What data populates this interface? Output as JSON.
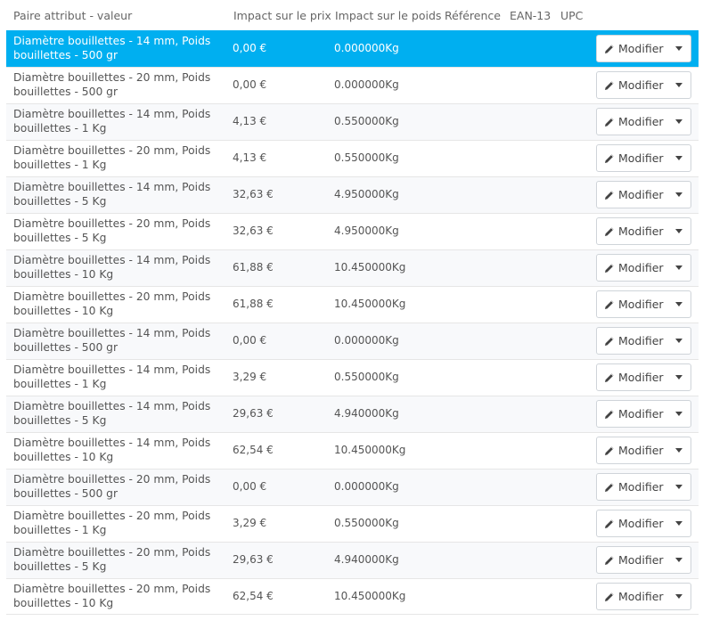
{
  "headers": {
    "attribute": "Paire attribut - valeur",
    "price": "Impact sur le prix",
    "weight": "Impact sur le poids",
    "reference": "Référence",
    "ean13": "EAN-13",
    "upc": "UPC"
  },
  "edit_label": "Modifier",
  "colors": {
    "selected_row": "#00aff0",
    "row_alt": "#f8f9fb"
  },
  "rows": [
    {
      "attr1": "Diamètre bouillettes - 14 mm, Poids",
      "attr2": "bouillettes - 500 gr",
      "price": "0,00 €",
      "weight": "0.000000Kg",
      "selected": true
    },
    {
      "attr1": "Diamètre bouillettes - 20 mm, Poids",
      "attr2": "bouillettes - 500 gr",
      "price": "0,00 €",
      "weight": "0.000000Kg"
    },
    {
      "attr1": "Diamètre bouillettes - 14 mm, Poids",
      "attr2": "bouillettes - 1 Kg",
      "price": "4,13 €",
      "weight": "0.550000Kg"
    },
    {
      "attr1": "Diamètre bouillettes - 20 mm, Poids",
      "attr2": "bouillettes - 1 Kg",
      "price": "4,13 €",
      "weight": "0.550000Kg"
    },
    {
      "attr1": "Diamètre bouillettes - 14 mm, Poids",
      "attr2": "bouillettes - 5 Kg",
      "price": "32,63 €",
      "weight": "4.950000Kg"
    },
    {
      "attr1": "Diamètre bouillettes - 20 mm, Poids",
      "attr2": "bouillettes - 5 Kg",
      "price": "32,63 €",
      "weight": "4.950000Kg"
    },
    {
      "attr1": "Diamètre bouillettes - 14 mm, Poids",
      "attr2": "bouillettes - 10 Kg",
      "price": "61,88 €",
      "weight": "10.450000Kg"
    },
    {
      "attr1": "Diamètre bouillettes - 20 mm, Poids",
      "attr2": "bouillettes - 10 Kg",
      "price": "61,88 €",
      "weight": "10.450000Kg"
    },
    {
      "attr1": "Diamètre bouillettes - 14 mm, Poids",
      "attr2": "bouillettes - 500 gr",
      "price": "0,00 €",
      "weight": "0.000000Kg"
    },
    {
      "attr1": "Diamètre bouillettes - 14 mm, Poids",
      "attr2": "bouillettes - 1 Kg",
      "price": "3,29 €",
      "weight": "0.550000Kg"
    },
    {
      "attr1": "Diamètre bouillettes - 14 mm, Poids",
      "attr2": "bouillettes - 5 Kg",
      "price": "29,63 €",
      "weight": "4.940000Kg"
    },
    {
      "attr1": "Diamètre bouillettes - 14 mm, Poids",
      "attr2": "bouillettes - 10 Kg",
      "price": "62,54 €",
      "weight": "10.450000Kg"
    },
    {
      "attr1": "Diamètre bouillettes - 20 mm, Poids",
      "attr2": "bouillettes - 500 gr",
      "price": "0,00 €",
      "weight": "0.000000Kg"
    },
    {
      "attr1": "Diamètre bouillettes - 20 mm, Poids",
      "attr2": "bouillettes - 1 Kg",
      "price": "3,29 €",
      "weight": "0.550000Kg"
    },
    {
      "attr1": "Diamètre bouillettes - 20 mm, Poids",
      "attr2": "bouillettes - 5 Kg",
      "price": "29,63 €",
      "weight": "4.940000Kg"
    },
    {
      "attr1": "Diamètre bouillettes - 20 mm, Poids",
      "attr2": "bouillettes - 10 Kg",
      "price": "62,54 €",
      "weight": "10.450000Kg"
    }
  ]
}
